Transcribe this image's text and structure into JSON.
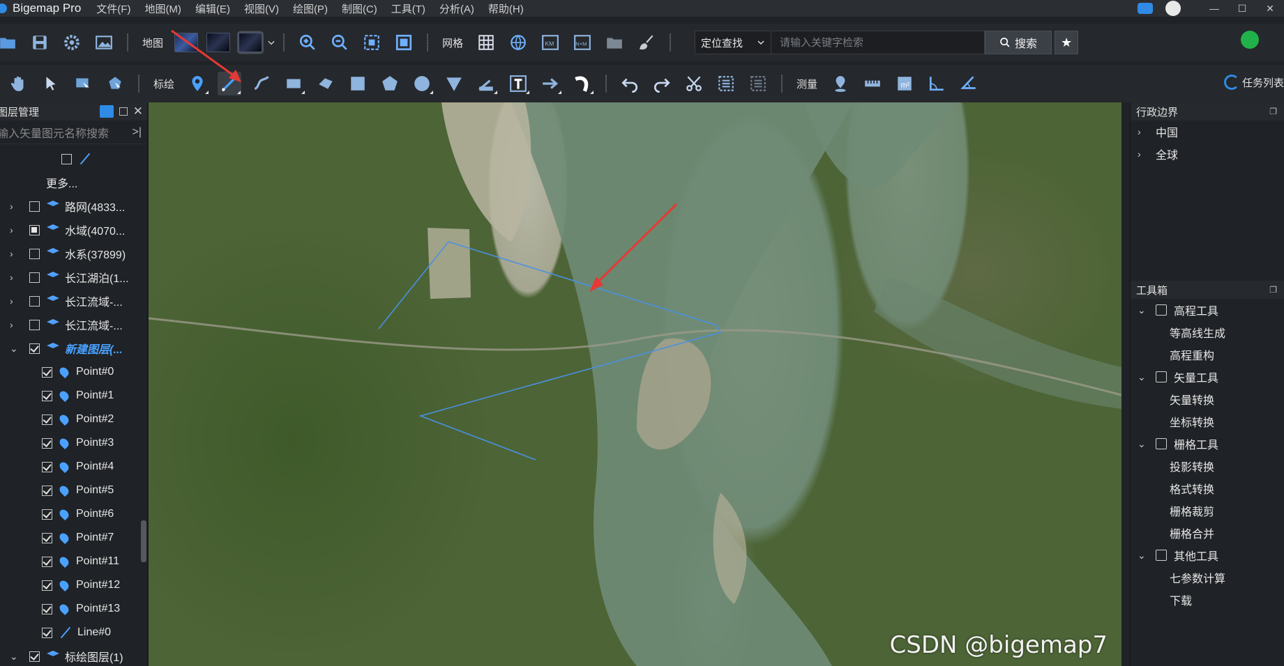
{
  "app": {
    "title": "Bigemap Pro"
  },
  "menu": [
    "文件(F)",
    "地图(M)",
    "编辑(E)",
    "视图(V)",
    "绘图(P)",
    "制图(C)",
    "工具(T)",
    "分析(A)",
    "帮助(H)"
  ],
  "toolbar1": {
    "map_label": "地图",
    "grid_label": "网格",
    "search": {
      "mode": "定位查找",
      "placeholder": "请输入关键字检索",
      "button": "搜索"
    }
  },
  "toolbar2": {
    "annotate_label": "标绘",
    "measure_label": "测量",
    "task_list": "任务列表"
  },
  "left_panel": {
    "title": "图层管理",
    "search_placeholder": "输入矢量图元名称搜索",
    "more": "更多...",
    "layers": [
      {
        "label": "路网(4833...",
        "checked": false
      },
      {
        "label": "水域(4070...",
        "checked": "partial"
      },
      {
        "label": "水系(37899)",
        "checked": false
      },
      {
        "label": "长江湖泊(1...",
        "checked": false
      },
      {
        "label": "长江流域-...",
        "checked": false
      },
      {
        "label": "长江流域-...",
        "checked": false
      }
    ],
    "new_layer": "新建图层(...",
    "children": [
      "Point#0",
      "Point#1",
      "Point#2",
      "Point#3",
      "Point#4",
      "Point#5",
      "Point#6",
      "Point#7",
      "Point#11",
      "Point#12",
      "Point#13",
      "Line#0"
    ],
    "annot_layer": "标绘图层(1)"
  },
  "right_panel": {
    "admin_title": "行政边界",
    "admin_items": [
      "中国",
      "全球"
    ],
    "toolbox_title": "工具箱",
    "groups": [
      {
        "name": "高程工具",
        "items": [
          "等高线生成",
          "高程重构"
        ]
      },
      {
        "name": "矢量工具",
        "items": [
          "矢量转换",
          "坐标转换"
        ]
      },
      {
        "name": "栅格工具",
        "items": [
          "投影转换",
          "格式转换",
          "栅格裁剪",
          "栅格合并"
        ]
      },
      {
        "name": "其他工具",
        "items": [
          "七参数计算",
          "下载"
        ]
      }
    ]
  },
  "watermark": "CSDN @bigemap7",
  "colors": {
    "accent": "#2f8be6",
    "annotation_arrow": "#e53935",
    "drawn_line": "#4a90e2"
  }
}
